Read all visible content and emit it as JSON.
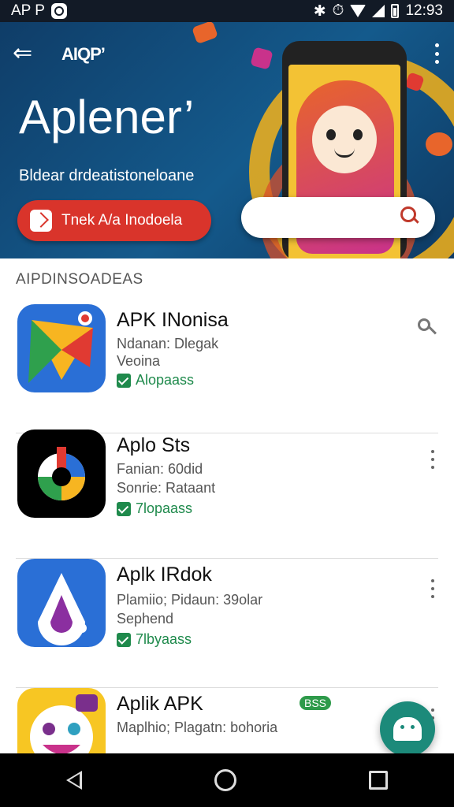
{
  "status_bar": {
    "left_text": "AP P",
    "time": "12:93"
  },
  "hero": {
    "logo_text": "AIQP’",
    "title": "Aplener’",
    "subtitle": "Bldear drdeatistoneloane",
    "cta_label": "Tnek A/a Inodoela",
    "search_placeholder": ""
  },
  "section": {
    "header": "AIPDINSOADEAS"
  },
  "apps": [
    {
      "name": "APK INonisa",
      "meta_line1": "Ndanan: Dlegak",
      "meta_line2": "Veoina",
      "badge": "Alopaass",
      "colors": [
        "#f7b521",
        "#e03a32",
        "#2a6fd6",
        "#2fa04d"
      ]
    },
    {
      "name": "Aplo Sts",
      "meta_line1": "Fanian: 60did",
      "meta_line2": "Sonrie: Rataant",
      "badge": "7lopaass",
      "colors": [
        "#000000",
        "#e03a32",
        "#2a6fd6",
        "#f7b521"
      ]
    },
    {
      "name": "Aplk IRdok",
      "meta_line1": "Plamiio; Pidaun: 39olar",
      "meta_line2": "Sephend",
      "badge": "7lbyaass",
      "colors": [
        "#2a6fd6",
        "#ffffff",
        "#8b2fa0"
      ]
    },
    {
      "name": "Aplik APK",
      "meta_line1": "Maplhio; Plagatn: bohoria",
      "meta_line2": "",
      "badge": "",
      "new_badge": "BSS",
      "colors": [
        "#f7c623",
        "#7a2f8c",
        "#ffffff"
      ]
    }
  ],
  "accent_colors": {
    "hero_bg": "#145a8c",
    "cta": "#d9342b",
    "badge_green": "#1f8a4c",
    "fab": "#1c8a7a"
  }
}
